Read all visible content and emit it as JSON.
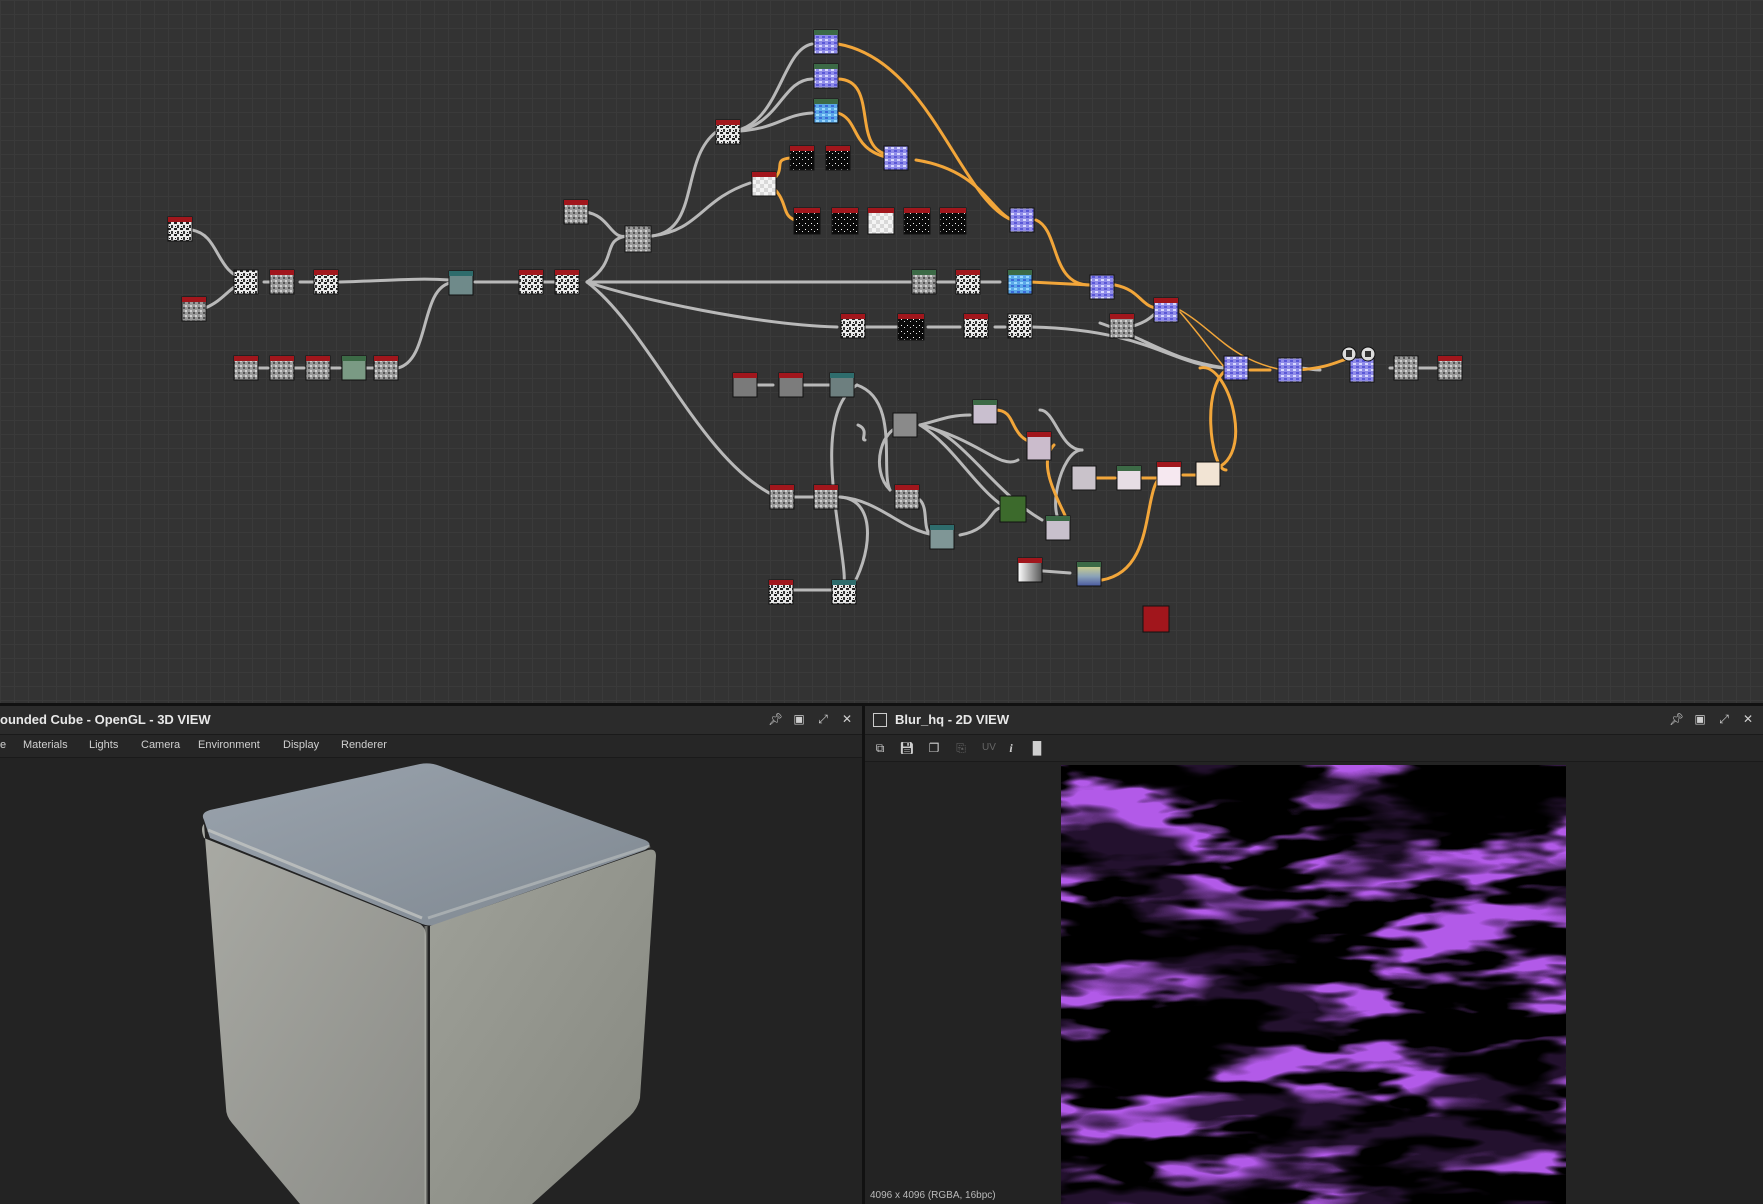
{
  "graph": {
    "colors": {
      "wire": "#b9b9b9",
      "wire_active": "#f2a63a",
      "node_header": "#a1161c",
      "node_border": "#1a1a1a"
    }
  },
  "panel_3d": {
    "title": "ounded Cube - OpenGL - 3D VIEW",
    "menu": [
      "e",
      "Materials",
      "Lights",
      "Camera",
      "Environment",
      "Display",
      "Renderer"
    ],
    "buttons": {
      "pin": "pin-icon",
      "float": "float-icon",
      "maximize": "maximize-icon",
      "close": "close-icon"
    }
  },
  "panel_2d": {
    "title": "Blur_hq - 2D VIEW",
    "uv_label": "UV",
    "info_label": "i",
    "status": "4096 x 4096 (RGBA, 16bpc)",
    "buttons": {
      "pin": "pin-icon",
      "float": "float-icon",
      "maximize": "maximize-icon",
      "close": "close-icon"
    }
  }
}
